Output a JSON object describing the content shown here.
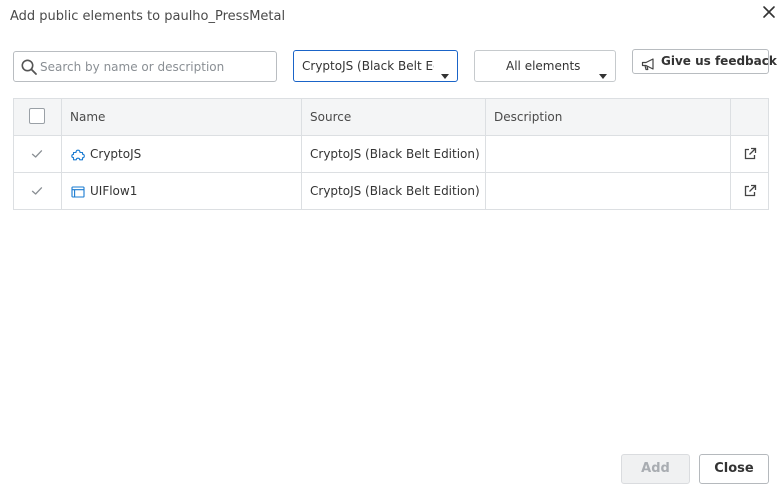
{
  "dialog": {
    "title": "Add public elements to paulho_PressMetal"
  },
  "toolbar": {
    "search_placeholder": "Search by name or description",
    "search_value": "",
    "source_filter": "CryptoJS (Black Belt Edition)",
    "element_filter": "All elements",
    "feedback_label": "Give us feedback"
  },
  "table": {
    "columns": [
      "",
      "Name",
      "Source",
      "Description",
      ""
    ],
    "rows": [
      {
        "icon": "extension-icon",
        "name": "CryptoJS",
        "source": "CryptoJS (Black Belt Edition)",
        "description": "",
        "selected": true
      },
      {
        "icon": "screen-flow-icon",
        "name": "UIFlow1",
        "source": "CryptoJS (Black Belt Edition)",
        "description": "",
        "selected": true
      }
    ]
  },
  "footer": {
    "add_label": "Add",
    "close_label": "Close"
  },
  "colors": {
    "accent": "#1a64c8",
    "icon_blue": "#1a7bd1"
  }
}
